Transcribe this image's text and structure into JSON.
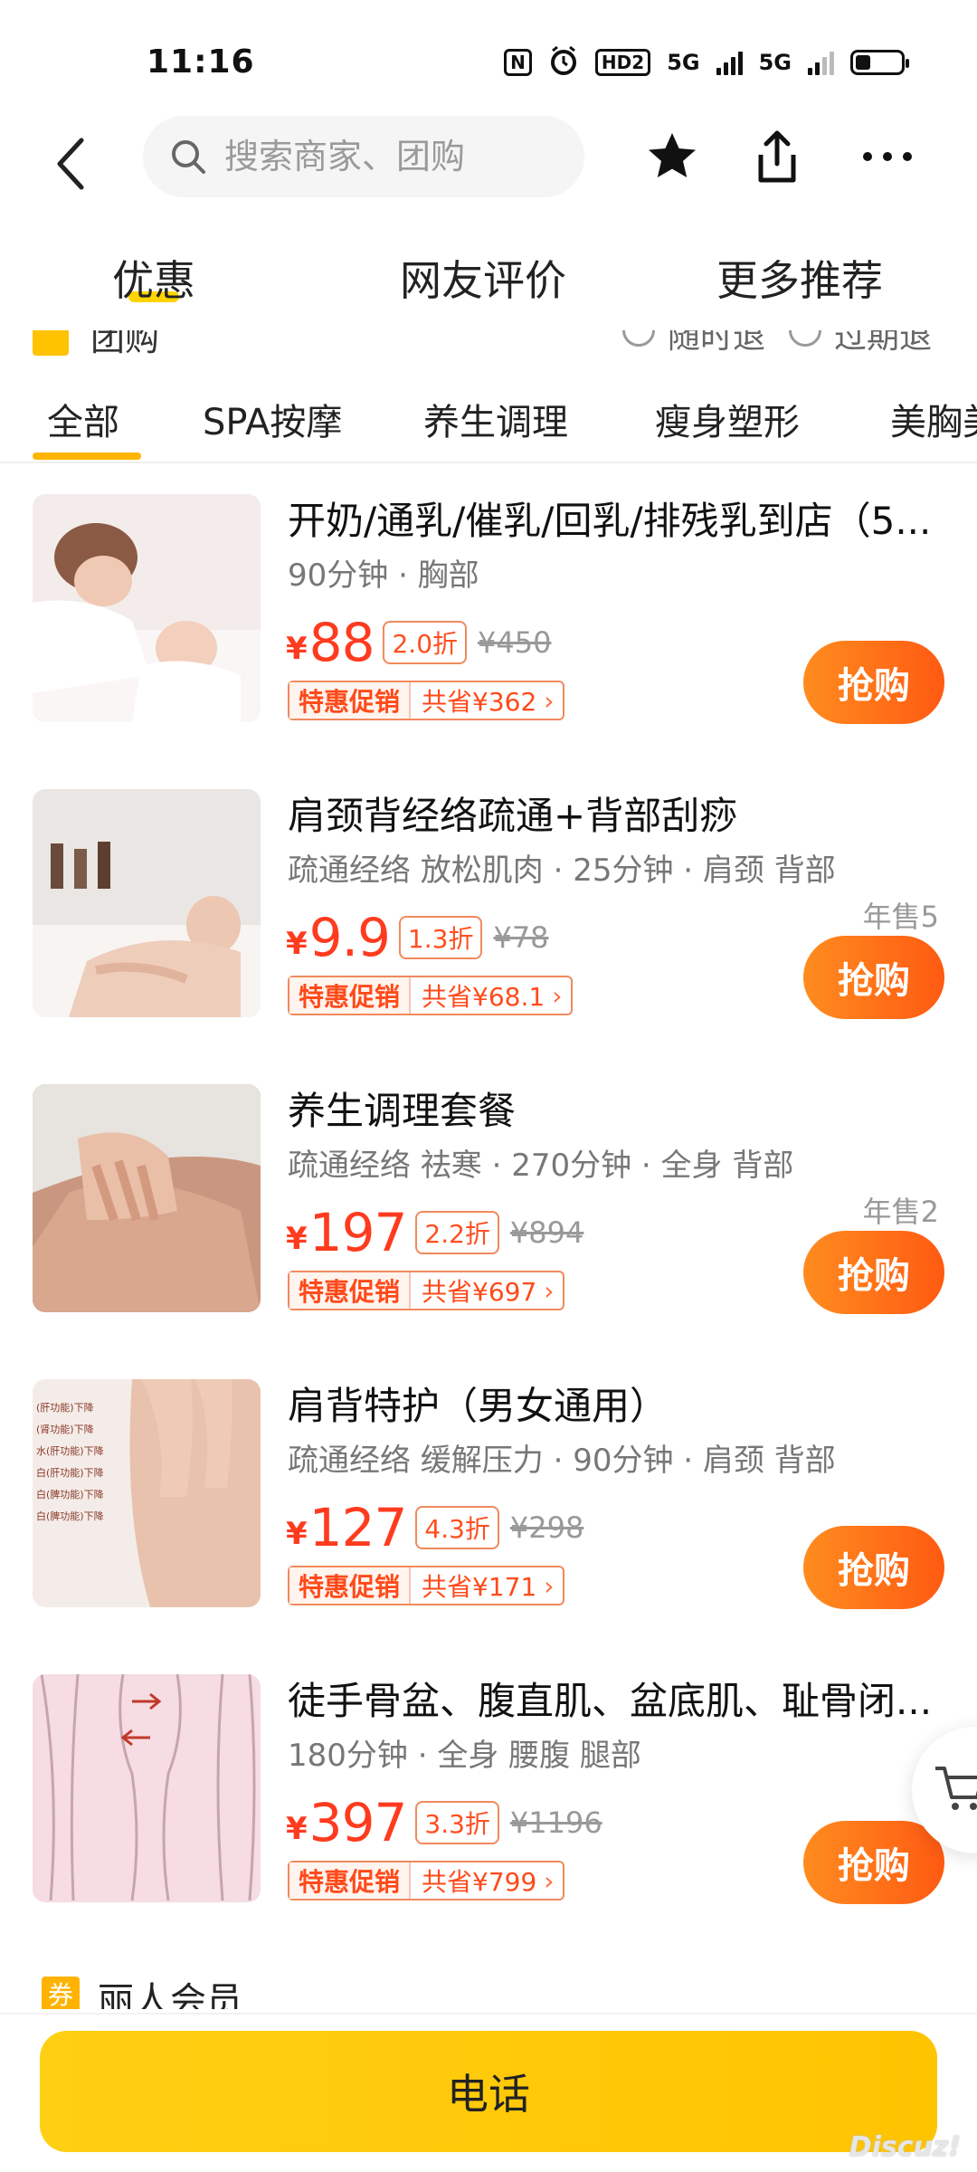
{
  "status_bar": {
    "time": "11:16",
    "nfc": "N",
    "hd": "HD2",
    "net1": "5G",
    "net2": "5G"
  },
  "top_nav": {
    "search_placeholder": "搜索商家、团购"
  },
  "section_tabs": [
    "优惠",
    "网友评价",
    "更多推荐"
  ],
  "sub_header": {
    "label": "团购",
    "option1": "随时退",
    "option2": "过期退"
  },
  "category_tabs": [
    "全部",
    "SPA按摩",
    "养生调理",
    "瘦身塑形",
    "美胸美"
  ],
  "products": [
    {
      "title": "开奶/通乳/催乳/回乳/排残乳到店（5...",
      "desc": "90分钟 · 胸部",
      "yen": "¥",
      "price": "88",
      "discount": "2.0折",
      "original": "¥450",
      "promo_tag": "特惠促销",
      "promo_save": "共省¥362",
      "yearly": "",
      "buy": "抢购"
    },
    {
      "title": "肩颈背经络疏通+背部刮痧",
      "desc": "疏通经络 放松肌肉 · 25分钟 · 肩颈 背部",
      "yen": "¥",
      "price": "9.9",
      "discount": "1.3折",
      "original": "¥78",
      "promo_tag": "特惠促销",
      "promo_save": "共省¥68.1",
      "yearly": "年售5",
      "buy": "抢购"
    },
    {
      "title": "养生调理套餐",
      "desc": "疏通经络 祛寒 · 270分钟 · 全身 背部",
      "yen": "¥",
      "price": "197",
      "discount": "2.2折",
      "original": "¥894",
      "promo_tag": "特惠促销",
      "promo_save": "共省¥697",
      "yearly": "年售2",
      "buy": "抢购"
    },
    {
      "title": "肩背特护（男女通用）",
      "desc": "疏通经络 缓解压力 · 90分钟 · 肩颈 背部",
      "yen": "¥",
      "price": "127",
      "discount": "4.3折",
      "original": "¥298",
      "promo_tag": "特惠促销",
      "promo_save": "共省¥171",
      "yearly": "",
      "buy": "抢购"
    },
    {
      "title": "徒手骨盆、腹直肌、盆底肌、耻骨闭...",
      "desc": "180分钟 · 全身 腰腹 腿部",
      "yen": "¥",
      "price": "397",
      "discount": "3.3折",
      "original": "¥1196",
      "promo_tag": "特惠促销",
      "promo_save": "共省¥799",
      "yearly": "",
      "buy": "抢购"
    }
  ],
  "member": {
    "flag": "券",
    "label": "丽人会员"
  },
  "bottom": {
    "call": "电话"
  },
  "watermark": "Discuz!",
  "thumb4_lines": [
    "(肝功能)下降",
    "(肾功能)下降",
    "水(肝功能)下降",
    "白(肝功能)下降",
    "白(脾功能)下降",
    "白(脾功能)下降"
  ],
  "colors": {
    "accent_yellow": "#ffc400",
    "price_red": "#ff3b1f",
    "buy_orange": "#ff6a14"
  }
}
